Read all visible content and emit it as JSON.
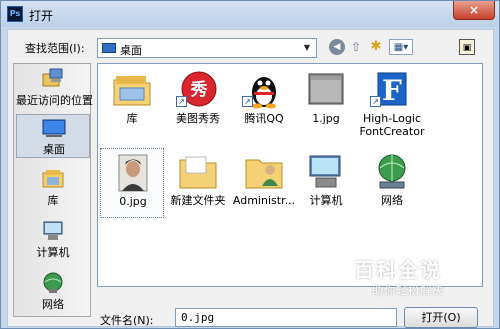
{
  "window": {
    "title": "打开",
    "app_icon": "Ps",
    "close_label": "×"
  },
  "toolbar": {
    "look_in_label": "查找范围(I):",
    "look_in_value": "桌面",
    "icons": [
      "back-icon",
      "up-folder-icon",
      "new-folder-icon",
      "view-menu-icon",
      "desktop-icon"
    ]
  },
  "sidebar": {
    "items": [
      {
        "label": "最近访问的位置",
        "icon": "recent-places-icon",
        "active": false
      },
      {
        "label": "桌面",
        "icon": "desktop-icon",
        "active": true
      },
      {
        "label": "库",
        "icon": "library-icon",
        "active": false
      },
      {
        "label": "计算机",
        "icon": "computer-icon",
        "active": false
      },
      {
        "label": "网络",
        "icon": "network-icon",
        "active": false
      }
    ]
  },
  "files": [
    {
      "label": "库",
      "icon": "library-folder-icon"
    },
    {
      "label": "美图秀秀",
      "icon": "meitu-app-icon",
      "shortcut": true
    },
    {
      "label": "腾讯QQ",
      "icon": "qq-penguin-icon",
      "shortcut": true
    },
    {
      "label": "1.jpg",
      "icon": "image-file-icon"
    },
    {
      "label": "High-Logic FontCreator",
      "icon": "fontcreator-app-icon",
      "shortcut": true
    },
    {
      "label": "0.jpg",
      "icon": "photo-thumbnail-icon",
      "selected": true
    },
    {
      "label": "新建文件夹",
      "icon": "folder-icon"
    },
    {
      "label": "Administr...",
      "icon": "user-folder-icon"
    },
    {
      "label": "计算机",
      "icon": "computer-icon"
    },
    {
      "label": "网络",
      "icon": "network-icon"
    }
  ],
  "bottom": {
    "filename_label": "文件名(N):",
    "filename_value": "0.jpg",
    "open_button": "打开(O)"
  },
  "watermark": {
    "title": "百科全说",
    "subtitle": "助你轻松解决"
  }
}
